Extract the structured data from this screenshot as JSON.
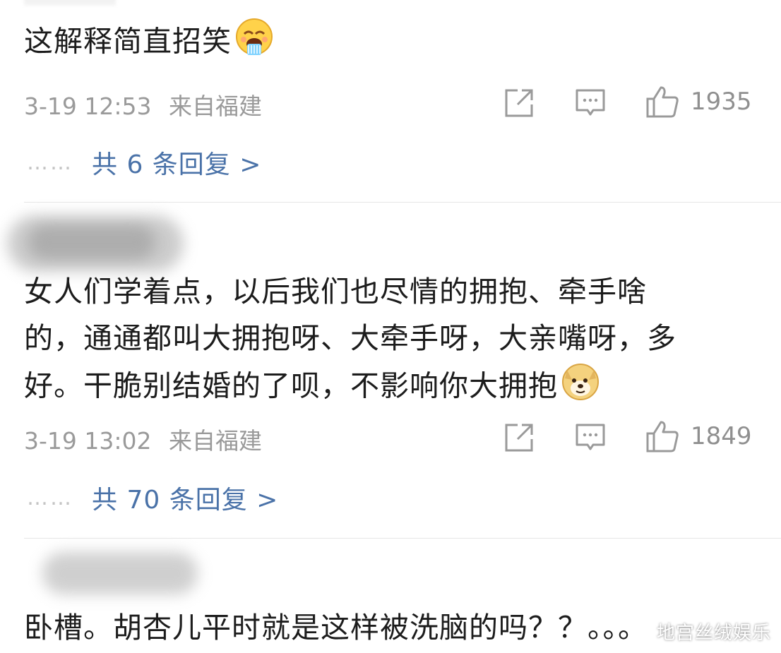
{
  "comments": [
    {
      "text_lines": [
        "这解释简直招笑"
      ],
      "emoji": "vomit-laugh-emoji",
      "time": "3-19 12:53",
      "location": "来自福建",
      "likes": "1935",
      "dots": "……",
      "replies_label": "共 6 条回复 >"
    },
    {
      "text_lines": [
        "女人们学着点，以后我们也尽情的拥抱、牵手啥",
        "的，通通都叫大拥抱呀、大牵手呀，大亲嘴呀，多",
        "好。干脆别结婚的了呗，不影响你大拥抱"
      ],
      "emoji": "doge-emoji",
      "time": "3-19 13:02",
      "location": "来自福建",
      "likes": "1849",
      "dots": "……",
      "replies_label": "共 70 条回复 >"
    },
    {
      "text_lines": [
        "卧槽。胡杏儿平时就是这样被洗脑的吗？？。。。"
      ]
    }
  ],
  "watermark": "地宫丝绒娱乐",
  "colors": {
    "link": "#4a72a8",
    "meta": "#9a9a9a",
    "text": "#1c1c1c"
  }
}
